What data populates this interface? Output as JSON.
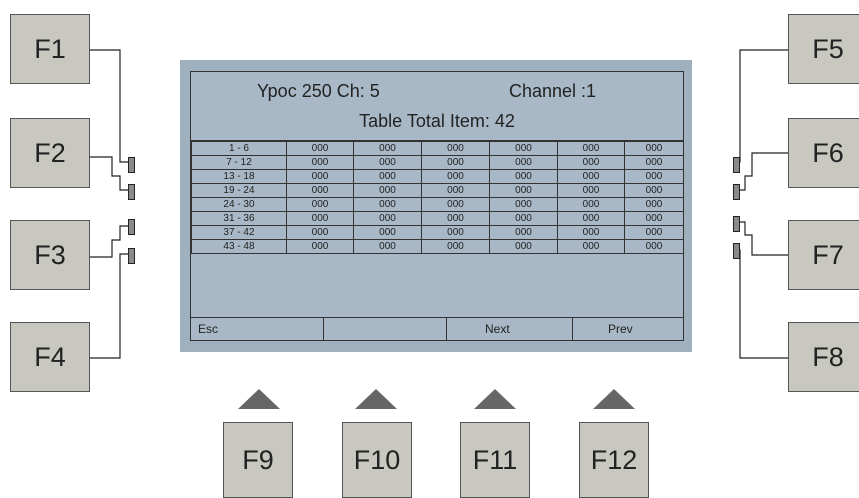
{
  "device": {
    "fkeys_left": [
      "F1",
      "F2",
      "F3",
      "F4"
    ],
    "fkeys_right": [
      "F5",
      "F6",
      "F7",
      "F8"
    ],
    "fkeys_bottom": [
      "F9",
      "F10",
      "F11",
      "F12"
    ]
  },
  "screen": {
    "model_label": "Ypoc 250  Ch: 5",
    "channel_label": "Channel :1",
    "total_label": "Table Total Item: 42",
    "rows": [
      {
        "range": "1 - 6",
        "values": [
          "000",
          "000",
          "000",
          "000",
          "000",
          "000"
        ]
      },
      {
        "range": "7 - 12",
        "values": [
          "000",
          "000",
          "000",
          "000",
          "000",
          "000"
        ]
      },
      {
        "range": "13 - 18",
        "values": [
          "000",
          "000",
          "000",
          "000",
          "000",
          "000"
        ]
      },
      {
        "range": "19 - 24",
        "values": [
          "000",
          "000",
          "000",
          "000",
          "000",
          "000"
        ]
      },
      {
        "range": "24 - 30",
        "values": [
          "000",
          "000",
          "000",
          "000",
          "000",
          "000"
        ]
      },
      {
        "range": "31 - 36",
        "values": [
          "000",
          "000",
          "000",
          "000",
          "000",
          "000"
        ]
      },
      {
        "range": "37 - 42",
        "values": [
          "000",
          "000",
          "000",
          "000",
          "000",
          "000"
        ]
      },
      {
        "range": "43 - 48",
        "values": [
          "000",
          "000",
          "000",
          "000",
          "000",
          "000"
        ]
      }
    ],
    "menu": [
      "Esc",
      "",
      "Next",
      "Prev"
    ]
  },
  "colors": {
    "key_fill": "#c8c8c0",
    "screen_bezel": "#9fb1bf",
    "screen_bg": "#a8b8c6",
    "arrow": "#666666"
  }
}
